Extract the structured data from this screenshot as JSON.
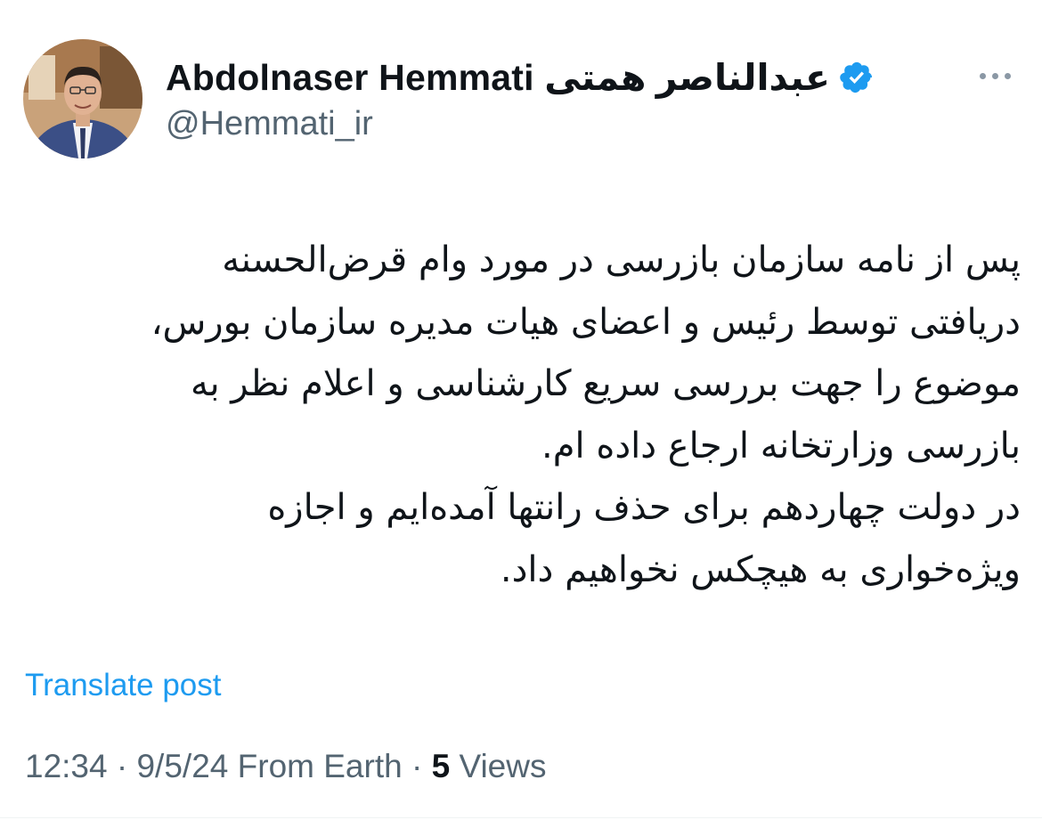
{
  "author": {
    "display_name": "Abdolnaser Hemmati عبدالناصر همتی",
    "handle": "@Hemmati_ir",
    "verified_icon": "verified-badge-icon",
    "avatar": "profile-photo"
  },
  "tweet": {
    "lines": [
      "پس از نامه سازمان بازرسی در مورد وام قرض‌الحسنه",
      "دریافتی توسط رئیس و اعضای هیات مدیره سازمان بورس،",
      "موضوع را جهت بررسی سریع کارشناسی و اعلام نظر به",
      "بازرسی وزارتخانه ارجاع داده ام.",
      "در دولت چهاردهم برای حذف رانتها آمده‌ایم و اجازه",
      "ویژه‌خواری به هیچکس نخواهیم داد."
    ]
  },
  "actions": {
    "translate_label": "Translate post",
    "more_icon": "more-options-icon"
  },
  "meta": {
    "time": "12:34",
    "separator": "·",
    "date": "9/5/24",
    "source": "From Earth",
    "views_count": "5",
    "views_label": "Views"
  },
  "colors": {
    "text": "#0f1419",
    "secondary": "#536471",
    "link": "#1d9bf0",
    "verified": "#1d9bf0"
  }
}
